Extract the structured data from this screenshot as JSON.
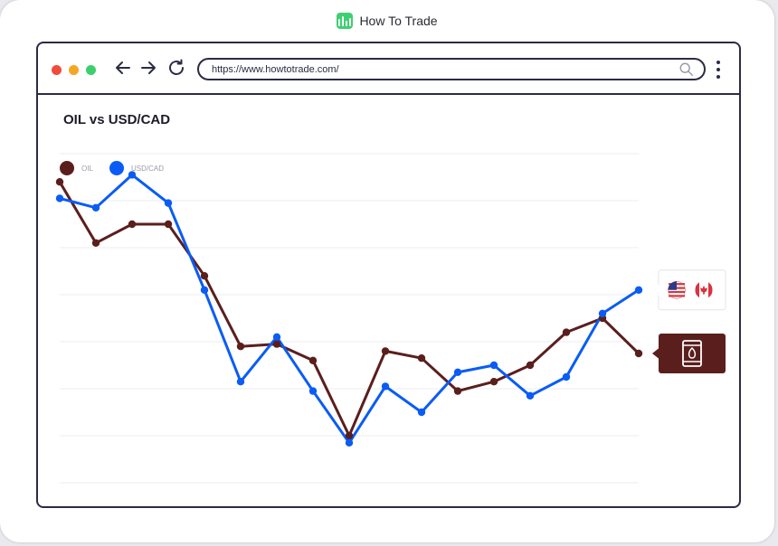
{
  "brand": {
    "name": "How To Trade",
    "logo_color": "#3fcf72"
  },
  "browser": {
    "window_controls": [
      "#f04c3c",
      "#f5a623",
      "#3ccf6e"
    ],
    "nav_icons": [
      "arrow-left-icon",
      "arrow-right-icon",
      "reload-icon"
    ],
    "url": "https://www.howtotrade.com/",
    "search_icon": "search-icon",
    "menu_icon": "kebab-menu-icon"
  },
  "chart_data": {
    "type": "line",
    "title": "OIL vs USD/CAD",
    "xlabel": "",
    "ylabel": "",
    "x": [
      1,
      2,
      3,
      4,
      5,
      6,
      7,
      8,
      9,
      10,
      11,
      12,
      13,
      14,
      15,
      16,
      17
    ],
    "ylim": [
      0,
      7
    ],
    "grid": true,
    "legend_position": "top-left",
    "series": [
      {
        "name": "OIL",
        "color": "#5a1f1d",
        "values": [
          6.4,
          5.1,
          5.5,
          5.5,
          4.4,
          2.9,
          2.95,
          2.6,
          1.0,
          2.8,
          2.65,
          1.95,
          2.15,
          2.5,
          3.2,
          3.5,
          2.75
        ],
        "end_marker": "oil-barrel-icon"
      },
      {
        "name": "USD/CAD",
        "color": "#0a5cf5",
        "values": [
          6.05,
          5.85,
          6.55,
          5.95,
          4.1,
          2.15,
          3.1,
          1.95,
          0.85,
          2.05,
          1.5,
          2.35,
          2.5,
          1.85,
          2.25,
          3.6,
          4.1
        ],
        "end_marker": "us-canada-flags-icon"
      }
    ]
  }
}
